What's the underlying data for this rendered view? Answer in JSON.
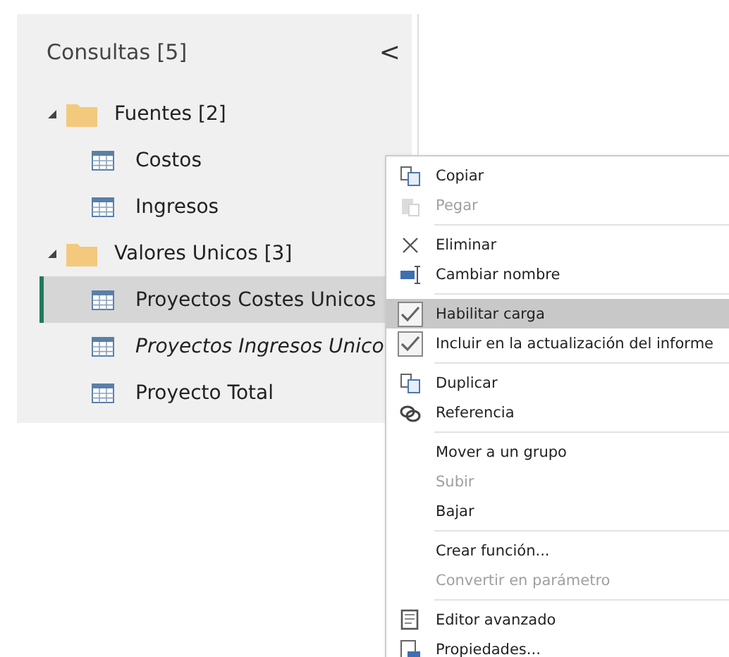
{
  "panel": {
    "title": "Consultas [5]",
    "collapse_glyph": "<",
    "groups": [
      {
        "label": "Fuentes [2]",
        "expanded": true,
        "children": [
          {
            "label": "Costos",
            "selected": false,
            "italic": false
          },
          {
            "label": "Ingresos",
            "selected": false,
            "italic": false
          }
        ]
      },
      {
        "label": "Valores Unicos [3]",
        "expanded": true,
        "children": [
          {
            "label": "Proyectos Costes Unicos",
            "selected": true,
            "italic": false
          },
          {
            "label": "Proyectos Ingresos Unico",
            "selected": false,
            "italic": true
          },
          {
            "label": "Proyecto Total",
            "selected": false,
            "italic": false
          }
        ]
      }
    ]
  },
  "context_menu": {
    "sections": [
      [
        {
          "label": "Copiar",
          "kind": "copy",
          "disabled": false,
          "selected": false
        },
        {
          "label": "Pegar",
          "kind": "paste",
          "disabled": true,
          "selected": false
        }
      ],
      [
        {
          "label": "Eliminar",
          "kind": "delete",
          "disabled": false,
          "selected": false
        },
        {
          "label": "Cambiar nombre",
          "kind": "rename",
          "disabled": false,
          "selected": false
        }
      ],
      [
        {
          "label": "Habilitar carga",
          "kind": "check",
          "checked": true,
          "disabled": false,
          "selected": true
        },
        {
          "label": "Incluir en la actualización del informe",
          "kind": "check",
          "checked": true,
          "disabled": false,
          "selected": false
        }
      ],
      [
        {
          "label": "Duplicar",
          "kind": "copy",
          "disabled": false,
          "selected": false
        },
        {
          "label": "Referencia",
          "kind": "link",
          "disabled": false,
          "selected": false
        }
      ],
      [
        {
          "label": "Mover a un grupo",
          "kind": "plain",
          "disabled": false,
          "selected": false
        },
        {
          "label": "Subir",
          "kind": "plain",
          "disabled": true,
          "selected": false
        },
        {
          "label": "Bajar",
          "kind": "plain",
          "disabled": false,
          "selected": false
        }
      ],
      [
        {
          "label": "Crear función...",
          "kind": "plain",
          "disabled": false,
          "selected": false
        },
        {
          "label": "Convertir en parámetro",
          "kind": "plain",
          "disabled": true,
          "selected": false
        }
      ],
      [
        {
          "label": "Editor avanzado",
          "kind": "editor",
          "disabled": false,
          "selected": false
        },
        {
          "label": "Propiedades...",
          "kind": "properties",
          "disabled": false,
          "selected": false
        }
      ]
    ]
  }
}
